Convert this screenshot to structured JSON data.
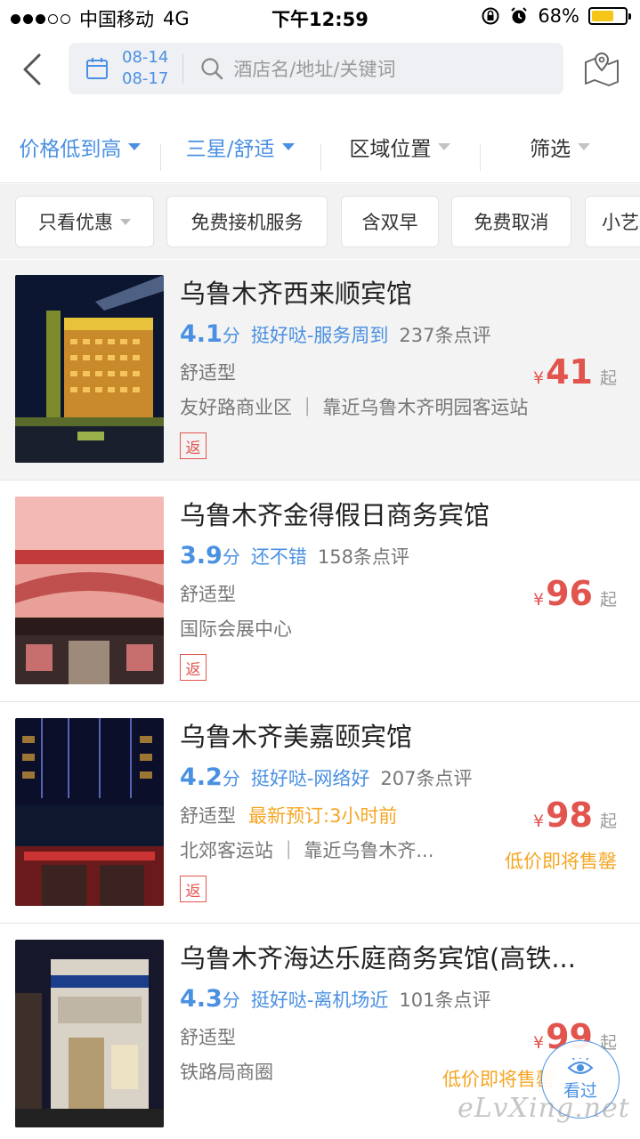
{
  "status_bar": {
    "carrier": "中国移动",
    "network": "4G",
    "time": "下午12:59",
    "battery": "68%",
    "battery_level": 0.68
  },
  "header": {
    "check_in": "08-14",
    "check_out": "08-17",
    "search_placeholder": "酒店名/地址/关键词"
  },
  "sort_bar": {
    "items": [
      {
        "label": "价格低到高",
        "active": true
      },
      {
        "label": "三星/舒适",
        "active": true
      },
      {
        "label": "区域位置",
        "active": false
      },
      {
        "label": "筛选",
        "active": false
      }
    ]
  },
  "filter_chips": [
    "只看优惠",
    "免费接机服务",
    "含双早",
    "免费取消",
    "小艺"
  ],
  "hotels": [
    {
      "name": "乌鲁木齐西来顺宾馆",
      "score": "4.1",
      "score_unit": "分",
      "tag": "挺好哒-服务周到",
      "reviews": "237条点评",
      "type": "舒适型",
      "urgent": "",
      "location": "友好路商业区 ｜ 靠近乌鲁木齐明园客运站",
      "badge": "返",
      "currency": "¥",
      "price": "41",
      "price_suffix": "起",
      "stock_note": ""
    },
    {
      "name": "乌鲁木齐金得假日商务宾馆",
      "score": "3.9",
      "score_unit": "分",
      "tag": "还不错",
      "reviews": "158条点评",
      "type": "舒适型",
      "urgent": "",
      "location": "国际会展中心",
      "badge": "返",
      "currency": "¥",
      "price": "96",
      "price_suffix": "起",
      "stock_note": ""
    },
    {
      "name": "乌鲁木齐美嘉颐宾馆",
      "score": "4.2",
      "score_unit": "分",
      "tag": "挺好哒-网络好",
      "reviews": "207条点评",
      "type": "舒适型",
      "urgent": "最新预订:3小时前",
      "location": "北郊客运站 ｜ 靠近乌鲁木齐...",
      "badge": "返",
      "currency": "¥",
      "price": "98",
      "price_suffix": "起",
      "stock_note": "低价即将售罄"
    },
    {
      "name": "乌鲁木齐海达乐庭商务宾馆(高铁...",
      "score": "4.3",
      "score_unit": "分",
      "tag": "挺好哒-离机场近",
      "reviews": "101条点评",
      "type": "舒适型",
      "urgent": "",
      "location": "铁路局商圈",
      "badge": "",
      "currency": "¥",
      "price": "99",
      "price_suffix": "起",
      "stock_note": "低价即将售罄"
    }
  ],
  "floating": {
    "viewed_label": "看过",
    "watermark": "eLvXing.net"
  },
  "colors": {
    "accent": "#4a90e2",
    "price": "#e2554f",
    "warning": "#f5a623"
  }
}
